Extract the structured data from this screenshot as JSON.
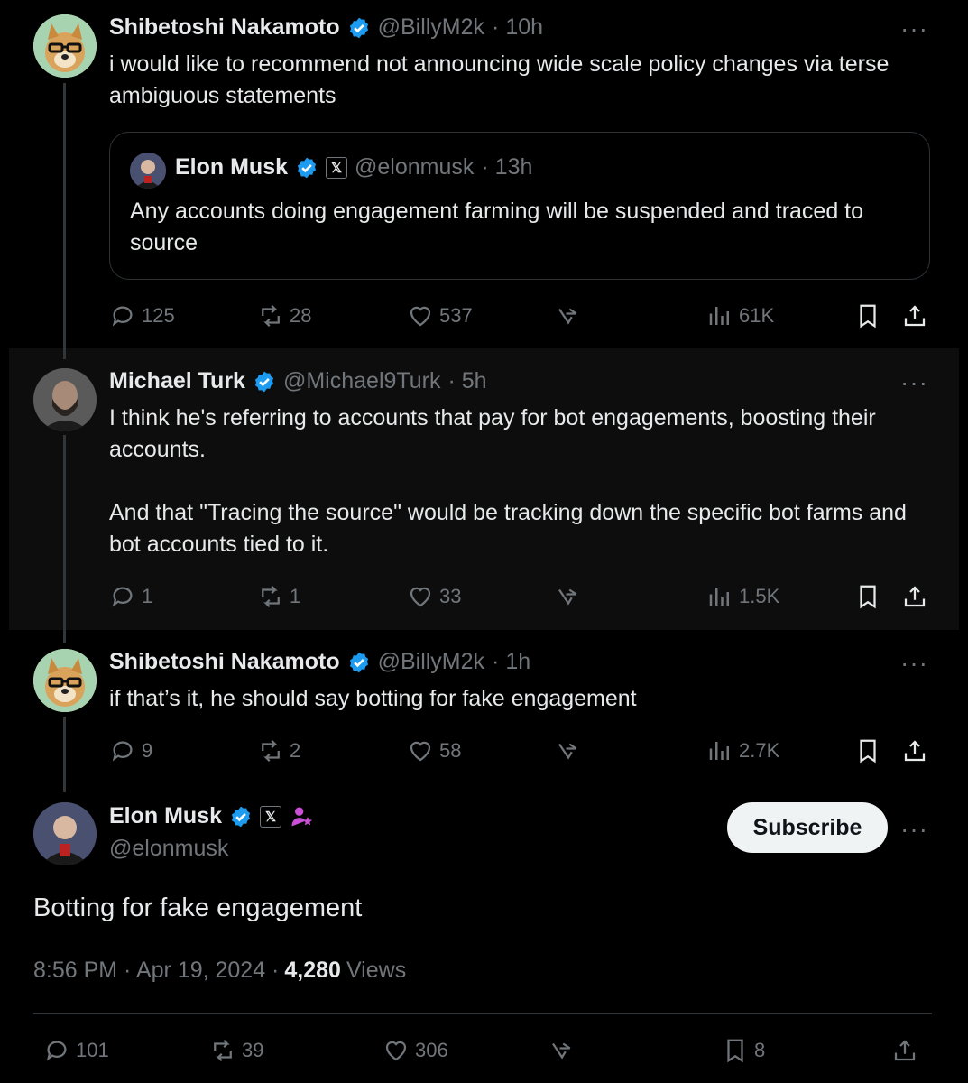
{
  "colors": {
    "background": "#000000",
    "text": "#e7e9ea",
    "muted": "#71767b",
    "verified": "#1d9bf0",
    "border": "#2f3336"
  },
  "tweet1": {
    "name": "Shibetoshi Nakamoto",
    "handle": "@BillyM2k",
    "time": "· 10h",
    "text": "i would like to recommend not announcing wide scale policy changes via terse ambiguous statements",
    "quote": {
      "name": "Elon Musk",
      "handle": "@elonmusk",
      "time": "· 13h",
      "text": "Any accounts doing engagement farming will be suspended and traced to source"
    },
    "replies": "125",
    "reposts": "28",
    "likes": "537",
    "views": "61K"
  },
  "tweet2": {
    "name": "Michael Turk",
    "handle": "@Michael9Turk",
    "time": "· 5h",
    "text": "I think he's referring to accounts that pay for bot engagements, boosting their accounts.\n\nAnd that \"Tracing the source\" would be tracking down the specific bot farms and bot accounts tied to it.",
    "replies": "1",
    "reposts": "1",
    "likes": "33",
    "views": "1.5K"
  },
  "tweet3": {
    "name": "Shibetoshi Nakamoto",
    "handle": "@BillyM2k",
    "time": "· 1h",
    "text": "if that’s it, he should say botting for fake engagement",
    "replies": "9",
    "reposts": "2",
    "likes": "58",
    "views": "2.7K"
  },
  "main": {
    "name": "Elon Musk",
    "handle": "@elonmusk",
    "subscribe_label": "Subscribe",
    "text": "Botting for fake engagement",
    "timestamp": "8:56 PM · Apr 19, 2024 ·",
    "views_count": "4,280",
    "views_label": "Views",
    "replies": "101",
    "reposts": "39",
    "likes": "306",
    "bookmarks": "8"
  },
  "icons": [
    "reply-icon",
    "repost-icon",
    "like-icon",
    "grok-icon",
    "views-icon",
    "bookmark-icon",
    "share-icon",
    "verified-badge-icon",
    "x-affiliate-icon",
    "more-icon"
  ]
}
